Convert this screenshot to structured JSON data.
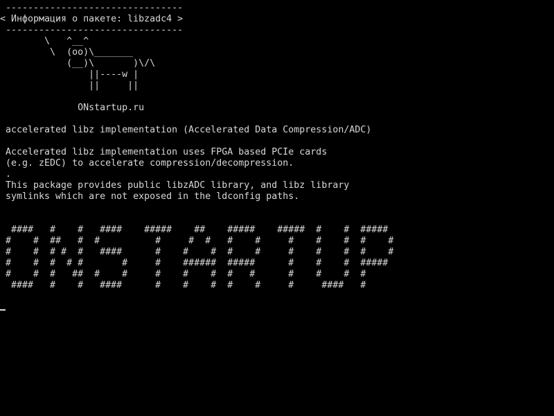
{
  "terminal": {
    "lines": [
      " --------------------------------",
      "< Информация о пакете: libzadc4 >",
      " --------------------------------",
      "        \\   ^__^",
      "         \\  (oo)\\_______",
      "            (__)\\       )\\/\\",
      "                ||----w |",
      "                ||     ||",
      "",
      "              ONstartup.ru",
      "",
      " accelerated libz implementation (Accelerated Data Compression/ADC)",
      "",
      " Accelerated libz implementation uses FPGA based PCIe cards",
      " (e.g. zEDC) to accelerate compression/decompression.",
      " .",
      " This package provides public libzADC library, and libz library",
      " symlinks which are not exposed in the ldconfig paths.",
      "",
      "",
      "  ####   #    #   ####    #####    ##    #####    #####  #    #  #####",
      " #    #  ##   #  #          #     #  #   #    #     #    #    #  #    #",
      " #    #  # #  #   ####      #    #    #  #    #     #    #    #  #    #",
      " #    #  #  # #       #     #    ######  #####      #    #    #  #####",
      " #    #  #   ##  #    #     #    #    #  #   #      #    #    #  #",
      "  ####   #    #   ####      #    #    #  #    #     #     ####   #"
    ],
    "colors": {
      "background": "#000000",
      "foreground": "#d8d8d8"
    }
  }
}
